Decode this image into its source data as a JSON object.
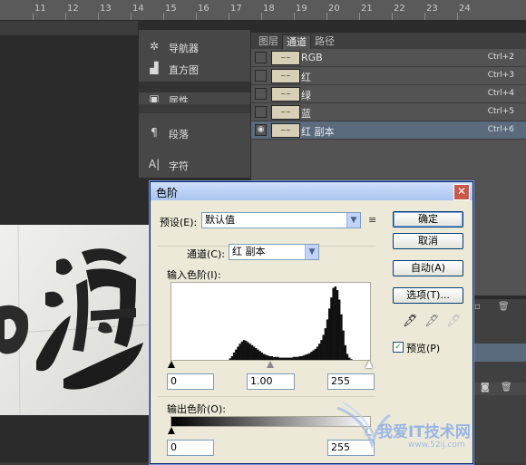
{
  "ruler": {
    "ticks": [
      "11",
      "12",
      "13",
      "14",
      "15",
      "16",
      "17",
      "18",
      "19",
      "20",
      "21",
      "22",
      "23",
      "24"
    ]
  },
  "tools_panel": {
    "items": [
      {
        "label": "导航器",
        "icon": "navigator-icon"
      },
      {
        "label": "直方图",
        "icon": "histogram-icon"
      },
      {
        "label": "属性",
        "icon": "properties-icon"
      },
      {
        "label": "段落",
        "icon": "paragraph-icon"
      },
      {
        "label": "字符",
        "icon": "character-icon"
      }
    ]
  },
  "channels_panel": {
    "tabs": [
      {
        "label": "图层"
      },
      {
        "label": "通道",
        "active": true
      },
      {
        "label": "路径"
      }
    ],
    "rows": [
      {
        "name": "RGB",
        "shortcut": "Ctrl+2",
        "selected": false
      },
      {
        "name": "红",
        "shortcut": "Ctrl+3",
        "selected": false
      },
      {
        "name": "绿",
        "shortcut": "Ctrl+4",
        "selected": false
      },
      {
        "name": "蓝",
        "shortcut": "Ctrl+5",
        "selected": false
      },
      {
        "name": "红 副本",
        "shortcut": "Ctrl+6",
        "selected": true
      }
    ]
  },
  "dialog": {
    "title": "色阶",
    "preset_label": "预设(E):",
    "preset_value": "默认值",
    "channel_label": "通道(C):",
    "channel_value": "红 副本",
    "input_levels_label": "输入色阶(I):",
    "input_black": "0",
    "input_gamma": "1.00",
    "input_white": "255",
    "output_levels_label": "输出色阶(O):",
    "output_black": "0",
    "output_white": "255",
    "buttons": {
      "ok": "确定",
      "cancel": "取消",
      "auto": "自动(A)",
      "options": "选项(T)..."
    },
    "preview_label": "预览(P)",
    "preview_checked": true
  },
  "histogram": {
    "note_levels": [
      0,
      0,
      0,
      0,
      0,
      0,
      0,
      0,
      0,
      0,
      0,
      0,
      0,
      0,
      0,
      0,
      0,
      0,
      0,
      0,
      0,
      0,
      0,
      0,
      0,
      0,
      0,
      0,
      0,
      0.02,
      0.05,
      0.1,
      0.14,
      0.18,
      0.22,
      0.25,
      0.27,
      0.26,
      0.24,
      0.22,
      0.2,
      0.18,
      0.16,
      0.14,
      0.12,
      0.1,
      0.08,
      0.07,
      0.06,
      0.05,
      0.05,
      0.04,
      0.04,
      0.04,
      0.03,
      0.03,
      0.03,
      0.03,
      0.03,
      0.03,
      0.03,
      0.04,
      0.04,
      0.04,
      0.05,
      0.05,
      0.06,
      0.07,
      0.08,
      0.09,
      0.11,
      0.13,
      0.15,
      0.18,
      0.22,
      0.27,
      0.34,
      0.43,
      0.55,
      0.7,
      0.85,
      0.98,
      1.0,
      0.95,
      0.82,
      0.62,
      0.4,
      0.2,
      0.08,
      0.03,
      0.01,
      0,
      0,
      0,
      0,
      0,
      0,
      0,
      0,
      0
    ]
  },
  "watermark": {
    "text": "我爱IT技术网",
    "url": "www.52ij.com"
  },
  "colors": {
    "dialog_bg": "#ece9d8",
    "titlebar": "#a9c4f0",
    "selected_row": "#5b6a7d"
  }
}
